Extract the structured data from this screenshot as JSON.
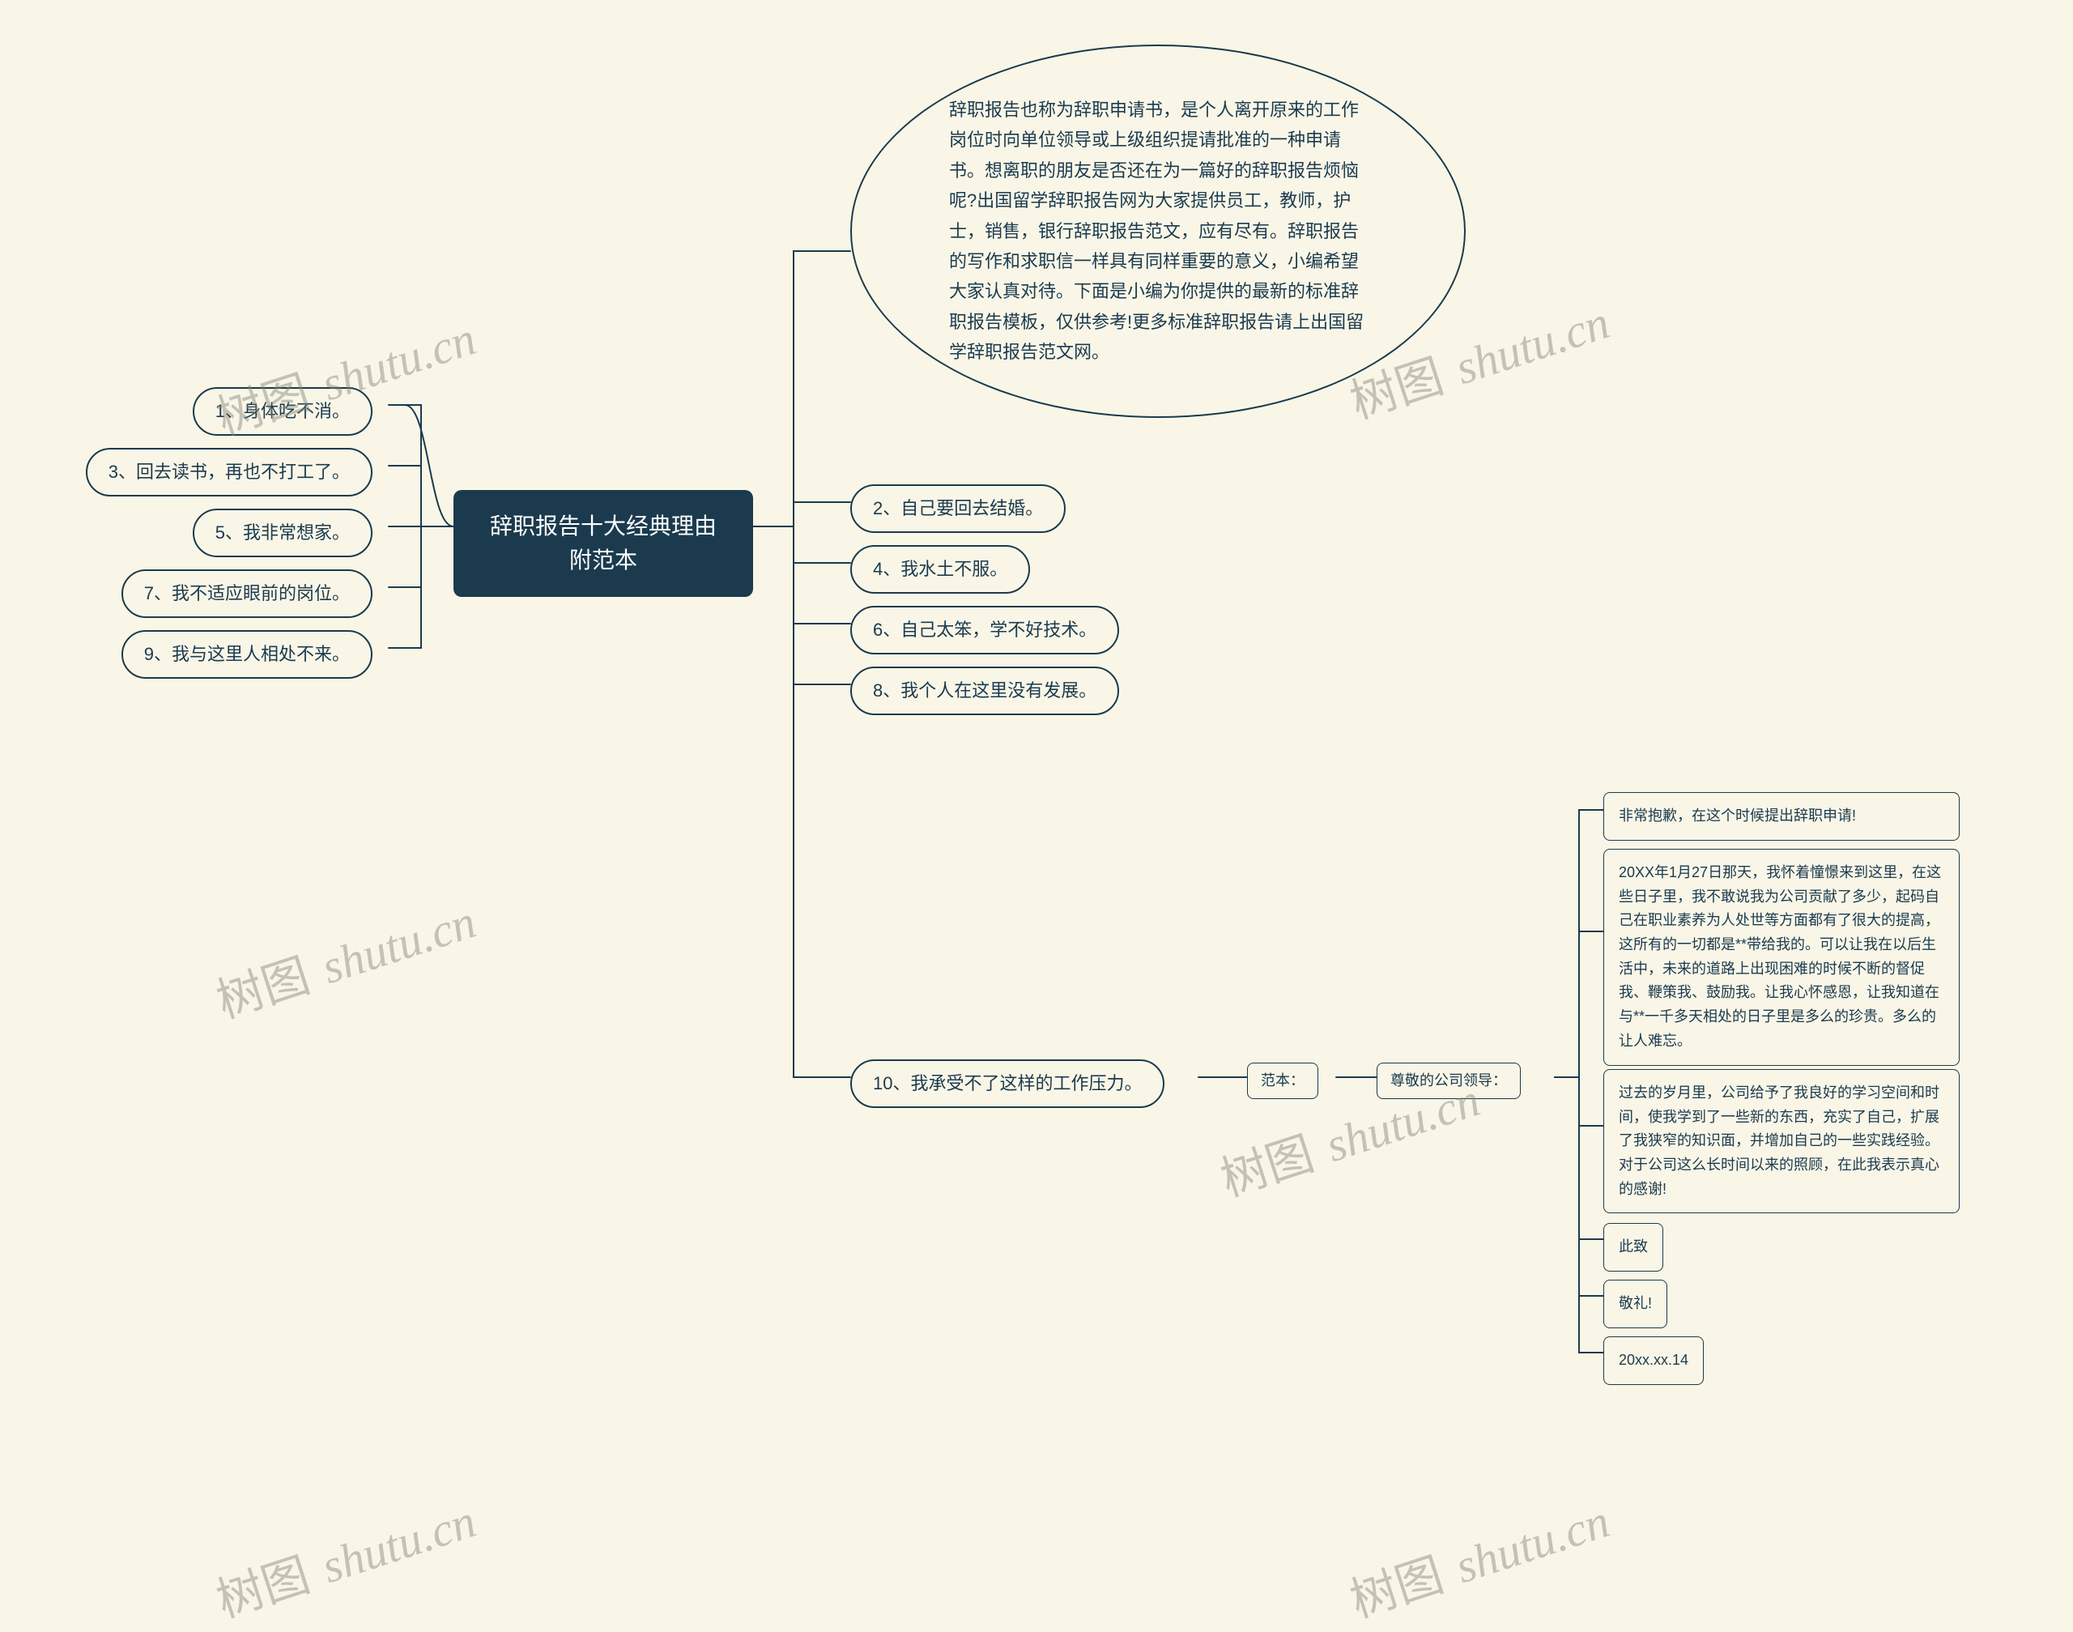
{
  "center": "辞职报告十大经典理由附范本",
  "left": {
    "n1": "1、身体吃不消。",
    "n3": "3、回去读书，再也不打工了。",
    "n5": "5、我非常想家。",
    "n7": "7、我不适应眼前的岗位。",
    "n9": "9、我与这里人相处不来。"
  },
  "right": {
    "intro": "辞职报告也称为辞职申请书，是个人离开原来的工作岗位时向单位领导或上级组织提请批准的一种申请书。想离职的朋友是否还在为一篇好的辞职报告烦恼呢?出国留学辞职报告网为大家提供员工，教师，护士，销售，银行辞职报告范文，应有尽有。辞职报告的写作和求职信一样具有同样重要的意义，小编希望大家认真对待。下面是小编为你提供的最新的标准辞职报告模板，仅供参考!更多标准辞职报告请上出国留学辞职报告范文网。",
    "n2": "2、自己要回去结婚。",
    "n4": "4、我水土不服。",
    "n6": "6、自己太笨，学不好技术。",
    "n8": "8、我个人在这里没有发展。",
    "n10": "10、我承受不了这样的工作压力。"
  },
  "sample": {
    "label": "范本：",
    "to": "尊敬的公司领导：",
    "p1": "非常抱歉，在这个时候提出辞职申请!",
    "p2": "20XX年1月27日那天，我怀着憧憬来到这里，在这些日子里，我不敢说我为公司贡献了多少，起码自己在职业素养为人处世等方面都有了很大的提高，这所有的一切都是**带给我的。可以让我在以后生活中，未来的道路上出现困难的时候不断的督促我、鞭策我、鼓励我。让我心怀感恩，让我知道在与**一千多天相处的日子里是多么的珍贵。多么的让人难忘。",
    "p3": "过去的岁月里，公司给予了我良好的学习空间和时间，使我学到了一些新的东西，充实了自己，扩展了我狭窄的知识面，并增加自己的一些实践经验。对于公司这么长时间以来的照顾，在此我表示真心的感谢!",
    "p4": "此致",
    "p5": "敬礼!",
    "p6": "20xx.xx.14"
  },
  "watermark": "树图 shutu.cn"
}
